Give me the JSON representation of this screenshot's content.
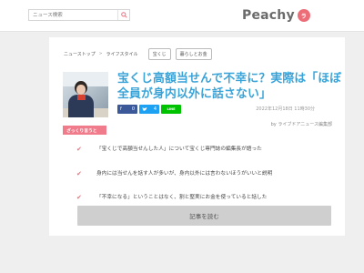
{
  "header": {
    "search_placeholder": "ニュース検索",
    "logo_text": "Peachy",
    "logo_badge": "ラ"
  },
  "breadcrumb": {
    "items": [
      "ニューストップ",
      "ライフスタイル"
    ],
    "separator": ">",
    "tags": [
      "宝くじ",
      "暮らしとお金"
    ]
  },
  "article": {
    "title": "宝くじ高額当せんで不幸に？実際は「ほぼ全員が身内以外に話さない」",
    "date": "2022年12月18日 11時30分",
    "byline": "by ライブドアニュース編集部",
    "label": "ざっくり言うと",
    "bullets": [
      "「宝くじで高額当せんした人」について宝くじ専門誌の編集長が語った",
      "身内には当せんを話す人が多いが、身内以外には言わないほうがいいと説明",
      "「不幸になる」ということはなく、割と堅実にお金を使っていると話した"
    ],
    "read_button": "記事を読む"
  },
  "share": {
    "facebook_count": "0",
    "twitter_count": "4",
    "line_label": "LINE"
  },
  "colors": {
    "title": "#39a3d8",
    "accent_pink": "#f07b8a",
    "facebook": "#3b5998",
    "twitter": "#1da1f2",
    "line": "#00c300"
  }
}
